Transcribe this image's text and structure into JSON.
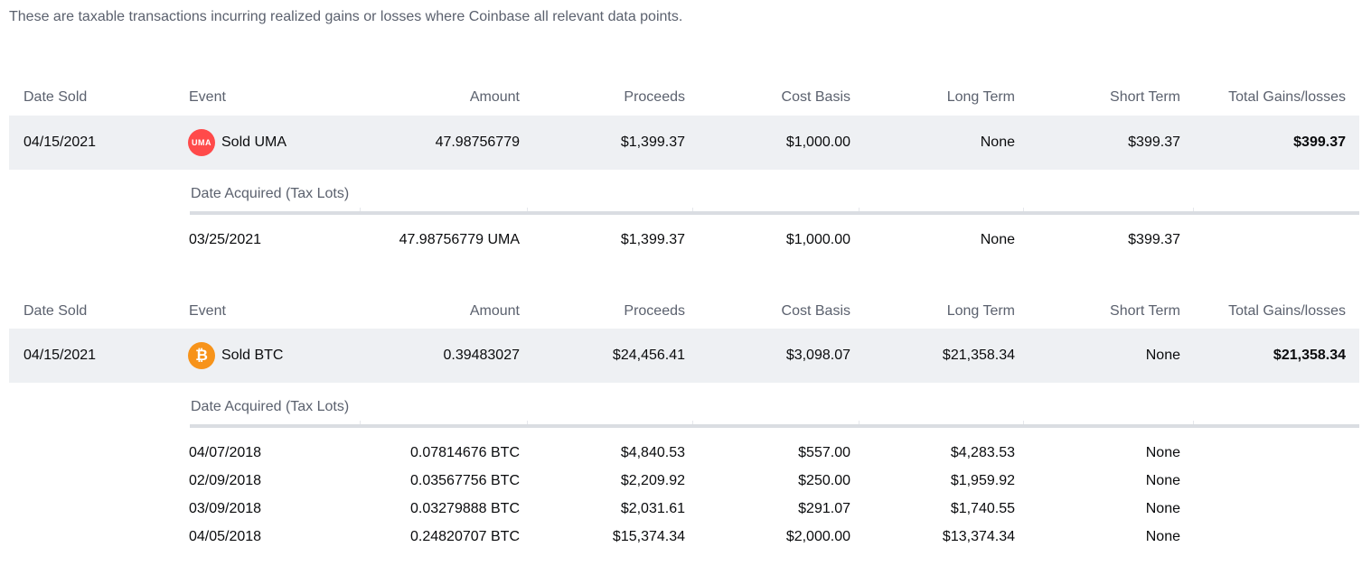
{
  "intro": "These are taxable transactions incurring realized gains or losses where Coinbase all relevant data points.",
  "headers": {
    "date_sold": "Date Sold",
    "event": "Event",
    "amount": "Amount",
    "proceeds": "Proceeds",
    "cost_basis": "Cost Basis",
    "long_term": "Long Term",
    "short_term": "Short Term",
    "total": "Total Gains/losses"
  },
  "lots_label": "Date Acquired (Tax Lots)",
  "transactions": [
    {
      "date_sold": "04/15/2021",
      "icon": "uma-coin-icon",
      "icon_text": "UMA",
      "icon_color": "#ff4a4a",
      "event": "Sold UMA",
      "amount": "47.98756779",
      "proceeds": "$1,399.37",
      "cost_basis": "$1,000.00",
      "long_term": "None",
      "short_term": "$399.37",
      "total": "$399.37",
      "lots": [
        {
          "date": "03/25/2021",
          "amount": "47.98756779 UMA",
          "proceeds": "$1,399.37",
          "cost_basis": "$1,000.00",
          "long_term": "None",
          "short_term": "$399.37"
        }
      ]
    },
    {
      "date_sold": "04/15/2021",
      "icon": "btc-coin-icon",
      "icon_text": "₿",
      "icon_color": "#f7931a",
      "event": "Sold BTC",
      "amount": "0.39483027",
      "proceeds": "$24,456.41",
      "cost_basis": "$3,098.07",
      "long_term": "$21,358.34",
      "short_term": "None",
      "total": "$21,358.34",
      "lots": [
        {
          "date": "04/07/2018",
          "amount": "0.07814676 BTC",
          "proceeds": "$4,840.53",
          "cost_basis": "$557.00",
          "long_term": "$4,283.53",
          "short_term": "None"
        },
        {
          "date": "02/09/2018",
          "amount": "0.03567756 BTC",
          "proceeds": "$2,209.92",
          "cost_basis": "$250.00",
          "long_term": "$1,959.92",
          "short_term": "None"
        },
        {
          "date": "03/09/2018",
          "amount": "0.03279888 BTC",
          "proceeds": "$2,031.61",
          "cost_basis": "$291.07",
          "long_term": "$1,740.55",
          "short_term": "None"
        },
        {
          "date": "04/05/2018",
          "amount": "0.24820707 BTC",
          "proceeds": "$15,374.34",
          "cost_basis": "$2,000.00",
          "long_term": "$13,374.34",
          "short_term": "None"
        }
      ]
    }
  ]
}
